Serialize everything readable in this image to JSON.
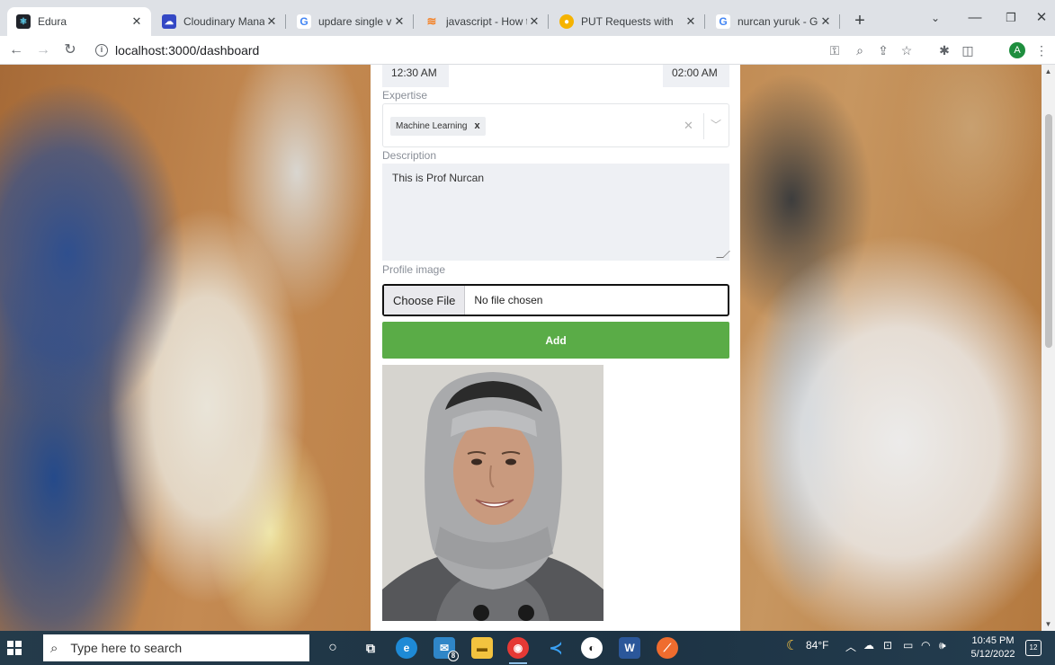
{
  "browser": {
    "tabs": [
      {
        "title": "Edura",
        "favicon": "react-favicon-icon",
        "active": true
      },
      {
        "title": "Cloudinary Manage",
        "favicon": "cloudinary-favicon-icon"
      },
      {
        "title": "updare single value",
        "favicon": "google-favicon-icon"
      },
      {
        "title": "javascript - How to",
        "favicon": "stackoverflow-favicon-icon"
      },
      {
        "title": "PUT Requests with",
        "favicon": "blog-favicon-icon"
      },
      {
        "title": "nurcan yuruk - Goo",
        "favicon": "google-favicon-icon"
      }
    ],
    "new_tab": "+",
    "url": "localhost:3000/dashboard",
    "profile_initial": "A"
  },
  "form": {
    "start_time": "12:30 AM",
    "end_time": "02:00 AM",
    "expertise_label": "Expertise",
    "expertise_chip": "Machine Learning",
    "chip_remove": "x",
    "description_label": "Description",
    "description_value": "This is Prof Nurcan",
    "profile_image_label": "Profile image",
    "choose_file_label": "Choose File",
    "no_file_text": "No file chosen",
    "add_button": "Add"
  },
  "taskbar": {
    "search_placeholder": "Type here to search",
    "mail_badge": "8",
    "weather": "84°F",
    "time": "10:45 PM",
    "date": "5/12/2022",
    "notifications": "12"
  },
  "colors": {
    "add_button": "#5aac47",
    "taskbar": "#1f3a4d",
    "field_bg": "#eef0f4"
  }
}
